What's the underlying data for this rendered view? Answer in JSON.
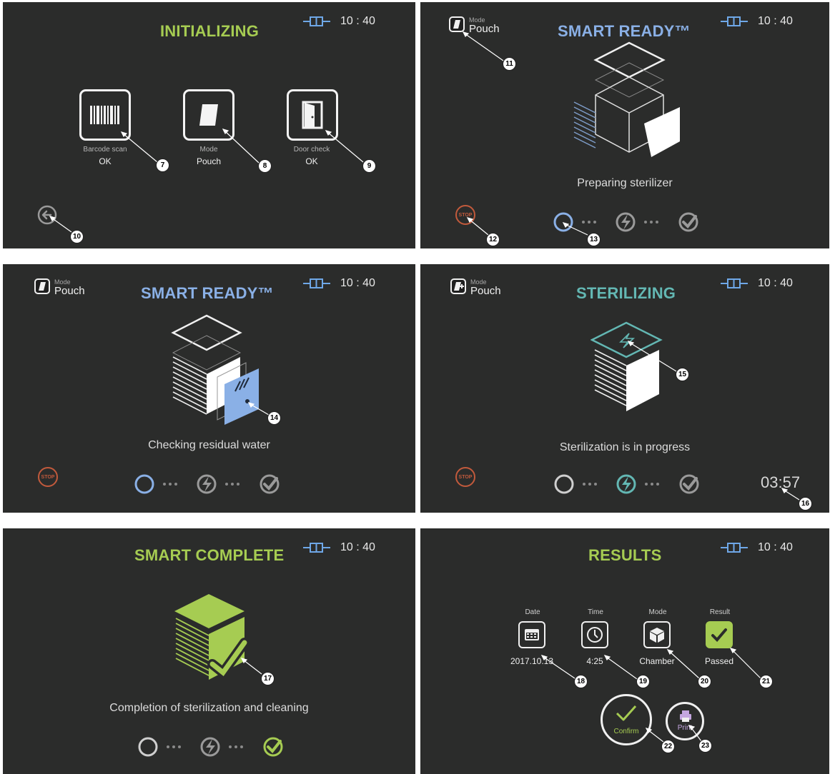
{
  "status_bar": {
    "time": "10 : 40"
  },
  "mode_tag": {
    "small": "Mode",
    "value": "Pouch"
  },
  "panels": {
    "initializing": {
      "title": "INITIALIZING",
      "items": [
        {
          "label": "Barcode scan",
          "value": "OK"
        },
        {
          "label": "Mode",
          "value": "Pouch"
        },
        {
          "label": "Door check",
          "value": "OK"
        }
      ]
    },
    "smart_ready_1": {
      "title": "SMART READY™",
      "status": "Preparing sterilizer"
    },
    "smart_ready_2": {
      "title": "SMART READY™",
      "status": "Checking residual water"
    },
    "sterilizing": {
      "title": "STERILIZING",
      "status": "Sterilization is in progress",
      "timer": "03:57"
    },
    "smart_complete": {
      "title": "SMART COMPLETE",
      "status": "Completion of sterilization and cleaning"
    },
    "results": {
      "title": "RESULTS",
      "items": [
        {
          "label": "Date",
          "value": "2017.10.13"
        },
        {
          "label": "Time",
          "value": "4:25"
        },
        {
          "label": "Mode",
          "value": "Chamber"
        },
        {
          "label": "Result",
          "value": "Passed"
        }
      ],
      "confirm_label": "Confirm",
      "print_label": "Print"
    }
  },
  "stop_label": "STOP",
  "callouts": [
    "7",
    "8",
    "9",
    "10",
    "11",
    "12",
    "13",
    "14",
    "15",
    "16",
    "17",
    "18",
    "19",
    "20",
    "21",
    "22",
    "23"
  ],
  "colors": {
    "panel_bg": "#2b2c2b",
    "ready_blue": "#8ab0e6",
    "green": "#a6cc52",
    "teal": "#63b7b3",
    "stop_orange": "#c25a3c",
    "battery_blue": "#6fa8e8"
  },
  "icons": {
    "battery": "battery-icon",
    "barcode": "barcode-icon",
    "pouch": "pouch-mode-icon",
    "door": "door-icon",
    "back": "back-arrow-icon",
    "stop": "stop-icon",
    "cycle": "cycle-circle-icon",
    "lightning": "lightning-icon",
    "check": "check-icon",
    "calendar": "calendar-icon",
    "clock": "clock-icon",
    "chamber": "chamber-mode-icon",
    "result": "result-check-icon",
    "printer": "printer-icon"
  }
}
